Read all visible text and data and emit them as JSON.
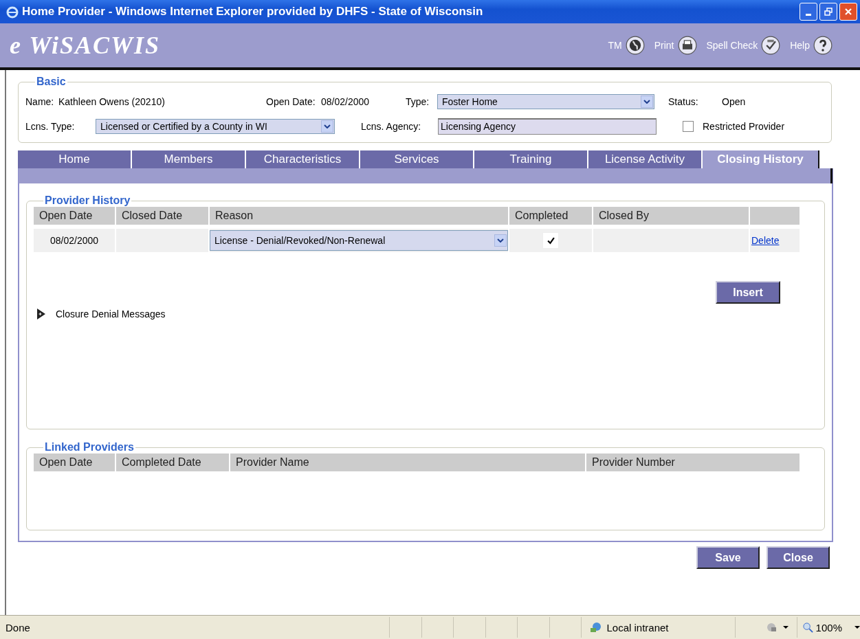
{
  "window": {
    "title": "Home Provider - Windows Internet Explorer provided by DHFS - State of Wisconsin"
  },
  "app_header": {
    "logo": "e WiSACWIS",
    "toolbar": [
      {
        "label": "TM",
        "kind": "globe"
      },
      {
        "label": "Print",
        "kind": "printer"
      },
      {
        "label": "Spell Check",
        "kind": "spellcheck"
      },
      {
        "label": "Help",
        "kind": "help"
      }
    ]
  },
  "basic": {
    "legend": "Basic",
    "name": {
      "label": "Name:",
      "value": "Kathleen Owens (20210)"
    },
    "open_date": {
      "label": "Open Date:",
      "value": "08/02/2000"
    },
    "type": {
      "label": "Type:",
      "value": "Foster Home"
    },
    "status": {
      "label": "Status:",
      "value": "Open"
    },
    "lcns_type": {
      "label": "Lcns. Type:",
      "value": "Licensed or Certified by a County in WI"
    },
    "lcns_agency": {
      "label": "Lcns. Agency:",
      "value": "Licensing Agency"
    },
    "restricted_provider": {
      "label": "Restricted Provider",
      "checked": false
    }
  },
  "tabs": [
    {
      "label": "Home",
      "selected": false
    },
    {
      "label": "Members",
      "selected": false
    },
    {
      "label": "Characteristics",
      "selected": false
    },
    {
      "label": "Services",
      "selected": false
    },
    {
      "label": "Training",
      "selected": false
    },
    {
      "label": "License Activity",
      "selected": false
    },
    {
      "label": "Closing History",
      "selected": true
    }
  ],
  "provider_history": {
    "legend": "Provider History",
    "columns": [
      "Open Date",
      "Closed Date",
      "Reason",
      "Completed",
      "Closed By"
    ],
    "rows": [
      {
        "open_date": "08/02/2000",
        "reason": "License - Denial/Revoked/Non-Renewal",
        "completed": true,
        "action": "Delete"
      }
    ],
    "insert_button": "Insert",
    "expander": {
      "label": "Closure Denial Messages",
      "expanded": false
    }
  },
  "linked_providers": {
    "legend": "Linked Providers",
    "columns": [
      "Open Date",
      "Completed Date",
      "Provider Name",
      "Provider Number"
    ]
  },
  "buttons": [
    "Save",
    "Close"
  ],
  "status_bar": {
    "text": "Done",
    "zone": "Local intranet",
    "zoom": "100%"
  }
}
